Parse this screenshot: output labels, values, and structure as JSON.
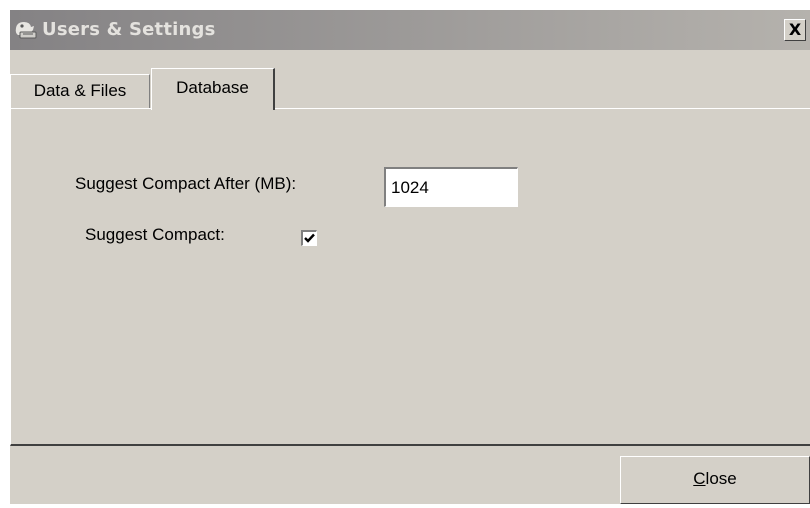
{
  "window": {
    "title": "Users & Settings",
    "close_glyph": "X",
    "icon": "users-settings-icon"
  },
  "tabs": [
    {
      "label": "Data & Files",
      "selected": false
    },
    {
      "label": "Database",
      "selected": true
    }
  ],
  "database": {
    "compact_after_label": "Suggest Compact After (MB):",
    "compact_after_value": "1024",
    "suggest_compact_label": "Suggest Compact:",
    "suggest_compact_checked": true
  },
  "footer": {
    "close_mnemonic": "C",
    "close_rest": "lose"
  },
  "colors": {
    "face": "#d4d0c8",
    "titlebar_start": "#848284",
    "titlebar_end": "#b5b2ad"
  }
}
